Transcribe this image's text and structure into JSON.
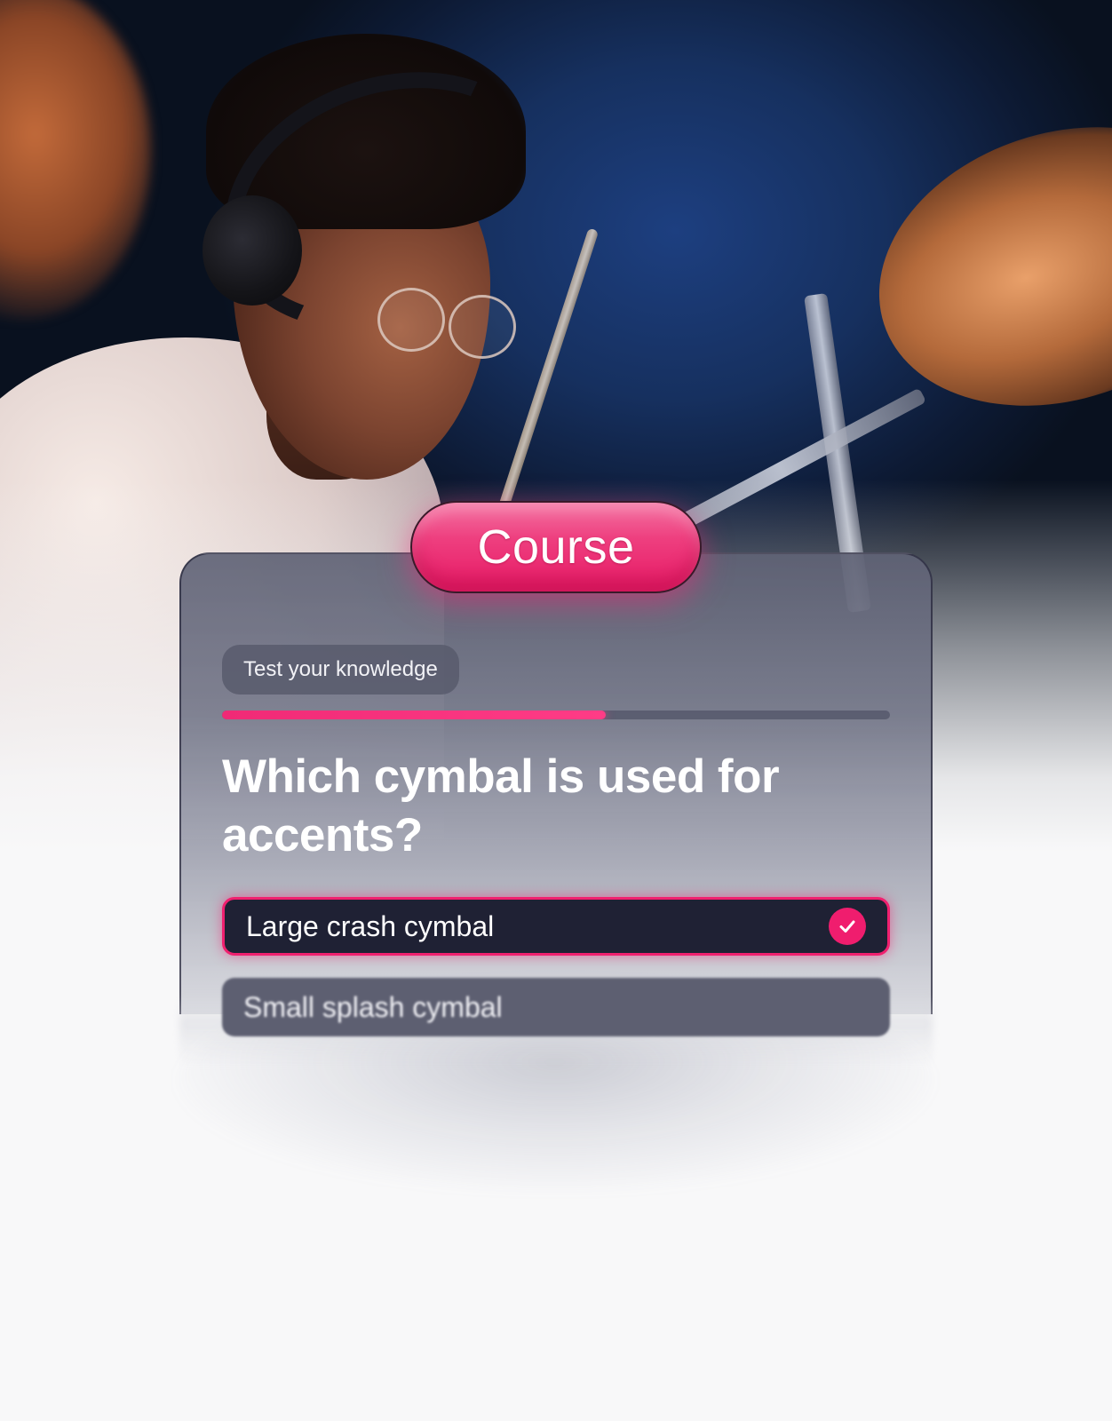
{
  "badge": {
    "label": "Course",
    "color": "#e81a66"
  },
  "quiz": {
    "section_label": "Test your knowledge",
    "progress": 0.575,
    "question": "Which cymbal is used for accents?",
    "options": [
      {
        "label": "Large crash cymbal",
        "selected": true,
        "status_icon": "check-icon"
      },
      {
        "label": "Small splash cymbal",
        "selected": false
      }
    ]
  },
  "colors": {
    "accent": "#f0206f",
    "option_selected_bg": "#1f2134",
    "option_bg": "#5d5f71"
  }
}
